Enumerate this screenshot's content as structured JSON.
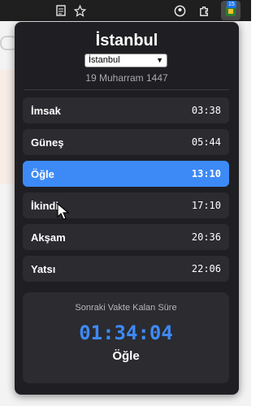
{
  "toolbar": {
    "icons": [
      "reader-icon",
      "star-icon",
      "account-icon",
      "extensions-icon",
      "extension-icon"
    ],
    "extension_badge": "15"
  },
  "popup": {
    "city_title": "İstanbul",
    "city_select": {
      "selected": "İstanbul"
    },
    "hijri_date": "19 Muharram 1447",
    "prayers": [
      {
        "name": "İmsak",
        "time": "03:38",
        "active": false
      },
      {
        "name": "Güneş",
        "time": "05:44",
        "active": false
      },
      {
        "name": "Öğle",
        "time": "13:10",
        "active": true
      },
      {
        "name": "İkindi",
        "time": "17:10",
        "active": false
      },
      {
        "name": "Akşam",
        "time": "20:36",
        "active": false
      },
      {
        "name": "Yatsı",
        "time": "22:06",
        "active": false
      }
    ],
    "countdown": {
      "label": "Sonraki Vakte Kalan Süre",
      "time": "01:34:04",
      "next_prayer": "Öğle"
    }
  },
  "colors": {
    "popup_bg": "#1f1f23",
    "row_bg": "#2b2b30",
    "accent": "#3d8af7"
  }
}
